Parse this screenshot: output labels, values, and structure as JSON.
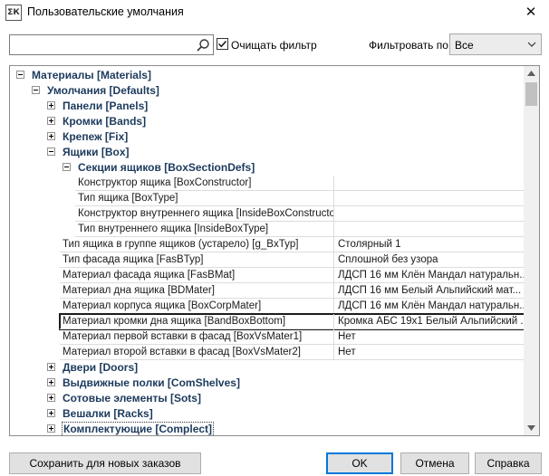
{
  "window": {
    "title": "Пользовательские умолчания",
    "icon_text": "ΣК",
    "close_glyph": "✕"
  },
  "filter": {
    "search_value": "",
    "search_placeholder": "",
    "clear_filter_label": "Очищать фильтр",
    "clear_filter_checked": true,
    "filter_by_label": "Фильтровать по:",
    "filter_by_value": "Все"
  },
  "tree": {
    "materials": "Материалы [Materials]",
    "defaults": "Умолчания [Defaults]",
    "panels": "Панели [Panels]",
    "bands": "Кромки [Bands]",
    "fix": "Крепеж [Fix]",
    "box": "Ящики [Box]",
    "box_section_defs": "Секции ящиков [BoxSectionDefs]",
    "doors": "Двери [Doors]",
    "com_shelves": "Выдвижные полки [ComShelves]",
    "sots": "Сотовые элементы [Sots]",
    "racks": "Вешалки [Racks]",
    "complect": "Комплектующие [Complect]"
  },
  "section_props": [
    {
      "name": "Конструктор ящика [BoxConstructor]",
      "value": ""
    },
    {
      "name": "Тип ящика [BoxType]",
      "value": ""
    },
    {
      "name": "Конструктор внутреннего ящика [InsideBoxConstructor]",
      "value": ""
    },
    {
      "name": "Тип внутреннего ящика [InsideBoxType]",
      "value": ""
    }
  ],
  "box_props": [
    {
      "name": "Тип ящика в группе ящиков (устарело) [g_BxTyp]",
      "value": "Столярный 1"
    },
    {
      "name": "Тип фасада ящика [FasBTyp]",
      "value": "Сплошной без узора"
    },
    {
      "name": "Материал фасада ящика [FasBMat]",
      "value": "ЛДСП 16 мм Клён Мандал натуральн..."
    },
    {
      "name": "Материал дна ящика [BDMater]",
      "value": "ЛДСП 16 мм Белый Альпийский мат..."
    },
    {
      "name": "Материал корпуса ящика [BoxCorpMater]",
      "value": "ЛДСП 16 мм Клён Мандал натуральн..."
    },
    {
      "name": "Материал кромки дна ящика [BandBoxBottom]",
      "value": "Кромка АБС 19х1 Белый Альпийский ..."
    },
    {
      "name": "Материал первой вставки в фасад [BoxVsMater1]",
      "value": "Нет"
    },
    {
      "name": "Материал второй вставки в фасад [BoxVsMater2]",
      "value": "Нет"
    }
  ],
  "buttons": {
    "save_new_orders": "Сохранить для новых заказов",
    "ok": "OK",
    "cancel": "Отмена",
    "help": "Справка"
  },
  "colors": {
    "node_text": "#1c3a5c",
    "default_button_border": "#0078d7"
  }
}
